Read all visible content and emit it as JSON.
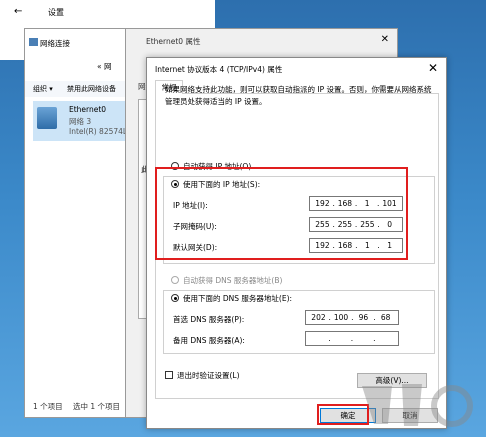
{
  "colors": {
    "accent": "#0078d7",
    "highlight": "#e01e1e",
    "desktop": "#3b89c9"
  },
  "settings_window": {
    "title": "设置",
    "back_icon": "back-arrow-icon"
  },
  "netconn_window": {
    "title": "网络连接",
    "address_text": "« 网",
    "toolbar": {
      "organize": "组织 ▾",
      "disable": "禁用此网络设备"
    },
    "adapter": {
      "name": "Ethernet0",
      "network": "网络 3",
      "device": "Intel(R) 82574L"
    },
    "status": {
      "count": "1 个项目",
      "selected": "选中 1 个项目"
    }
  },
  "eth_props_window": {
    "title": "Ethernet0 属性",
    "tab": "网络",
    "side_label": "此"
  },
  "dialog": {
    "title": "Internet 协议版本 4 (TCP/IPv4) 属性",
    "tab_general": "常规",
    "description": "如果网络支持此功能，则可以获取自动指派的 IP 设置。否则，你需要从网络系统管理员处获得适当的 IP 设置。",
    "auto_ip_label": "自动获得 IP 地址(O)",
    "manual_ip_label": "使用下面的 IP 地址(S):",
    "ip_address_label": "IP 地址(I):",
    "subnet_label": "子网掩码(U):",
    "gateway_label": "默认网关(D):",
    "ip_address": [
      "192",
      "168",
      "1",
      "101"
    ],
    "subnet": [
      "255",
      "255",
      "255",
      "0"
    ],
    "gateway": [
      "192",
      "168",
      "1",
      "1"
    ],
    "auto_dns_label": "自动获得 DNS 服务器地址(B)",
    "manual_dns_label": "使用下面的 DNS 服务器地址(E):",
    "preferred_dns_label": "首选 DNS 服务器(P):",
    "alternate_dns_label": "备用 DNS 服务器(A):",
    "preferred_dns": [
      "202",
      "100",
      "96",
      "68"
    ],
    "alternate_dns": [
      "",
      "",
      "",
      ""
    ],
    "validate_label": "退出时验证设置(L)",
    "advanced_button": "高级(V)...",
    "ok_button": "确定",
    "cancel_button": "取消"
  }
}
